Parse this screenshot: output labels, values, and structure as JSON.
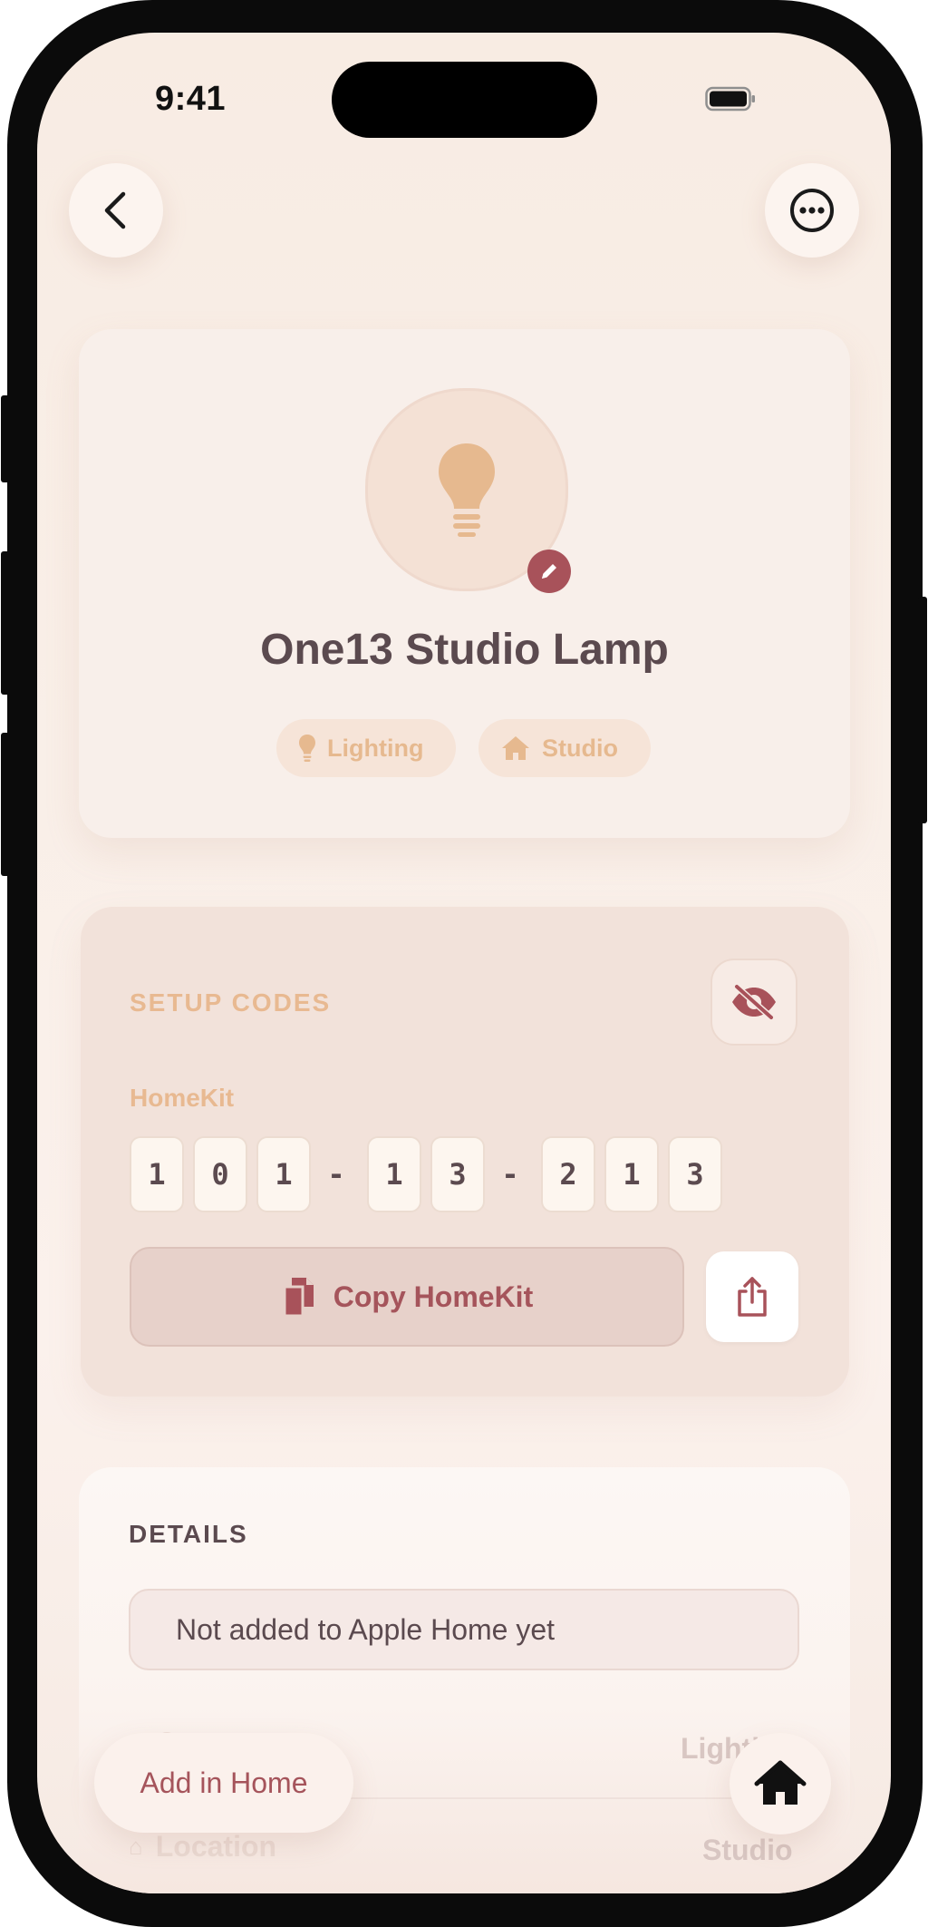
{
  "status_bar": {
    "time": "9:41"
  },
  "nav": {
    "back_icon": "chevron-left-icon",
    "more_icon": "ellipsis-circle-icon"
  },
  "device": {
    "name": "One13 Studio Lamp",
    "icon": "lightbulb-icon",
    "category": "Lighting",
    "location": "Studio"
  },
  "setup_codes": {
    "title": "SETUP CODES",
    "visibility_icon": "eye-slash-icon",
    "homekit_label": "HomeKit",
    "code": [
      "1",
      "0",
      "1",
      "-",
      "1",
      "3",
      "-",
      "2",
      "1",
      "3"
    ],
    "copy_label": "Copy HomeKit",
    "share_icon": "share-icon"
  },
  "details": {
    "title": "DETAILS",
    "status_text": "Not added to Apple Home yet",
    "rows": [
      {
        "label": "Category",
        "value": "Lighting"
      },
      {
        "label": "Location",
        "value": "Studio"
      }
    ]
  },
  "actions": {
    "add_in_home": "Add in Home",
    "home_icon": "house-icon"
  },
  "colors": {
    "accent": "#a8525a",
    "peach": "#e6b98f",
    "text_dark": "#5b4a4f",
    "background": "#f8ece3"
  }
}
